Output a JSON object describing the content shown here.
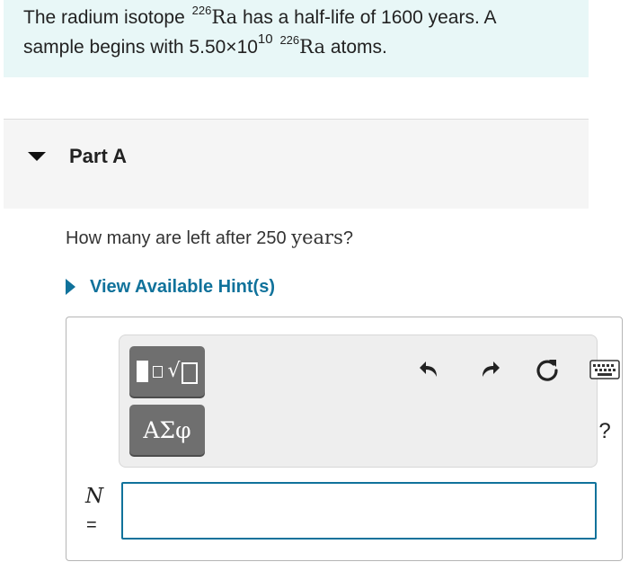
{
  "problem": {
    "text_1": "The radium isotope ",
    "isotope_mass": "226",
    "element": "Ra",
    "text_2": " has a half-life of 1600 years. A",
    "text_3": "sample begins with 5.50×10",
    "exponent": "10",
    "isotope_mass_2": "226",
    "element_2": "Ra",
    "text_4": " atoms."
  },
  "part": {
    "title": "Part A",
    "question_prefix": "How many are left after 250 ",
    "question_unit": "years",
    "question_suffix": "?"
  },
  "hint": {
    "label": "View Available Hint(s)"
  },
  "toolbar": {
    "symbols_label": "ΑΣφ",
    "help_label": "?"
  },
  "answer": {
    "variable": "N",
    "equals": "=",
    "value": "",
    "placeholder": ""
  },
  "colors": {
    "problem_bg": "#e8f7f7",
    "accent": "#10729b",
    "tool_button": "#6f6f6f"
  }
}
